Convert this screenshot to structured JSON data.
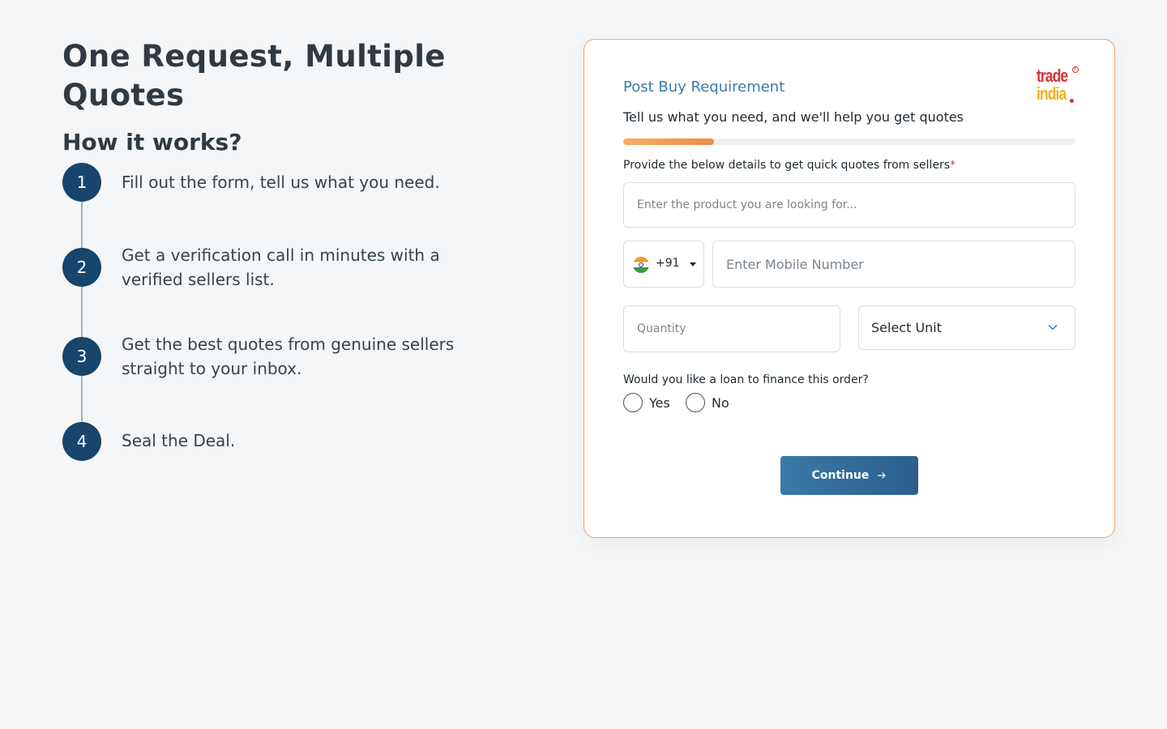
{
  "left": {
    "headline": "One Request, Multiple Quotes",
    "subhead": "How it works?",
    "steps": [
      {
        "number": "1",
        "text": "Fill out the form, tell us what you need."
      },
      {
        "number": "2",
        "text": "Get a verification call in minutes with a verified sellers list."
      },
      {
        "number": "3",
        "text": "Get the best quotes from genuine sellers straight to your inbox."
      },
      {
        "number": "4",
        "text": "Seal the Deal."
      }
    ]
  },
  "form": {
    "title": "Post Buy Requirement",
    "subtitle": "Tell us what you need, and we'll help you get quotes",
    "logo": {
      "line1": "trade",
      "line2": "india",
      "registered": "R"
    },
    "progress_fraction": 0.2,
    "details_label": "Provide the below details to get quick quotes from sellers",
    "required_marker": "*",
    "product_placeholder": "Enter the product you are looking for...",
    "country": {
      "flag_icon": "india-flag-icon",
      "code": "+91"
    },
    "mobile_placeholder": "Enter Mobile Number",
    "quantity_placeholder": "Quantity",
    "unit_select": "Select Unit",
    "loan_question": "Would you like a loan to finance this order?",
    "loan_options": [
      "Yes",
      "No"
    ],
    "continue_label": "Continue"
  },
  "colors": {
    "accent": "#17456b",
    "title_blue": "#3c7ba9",
    "card_border": "#f0a572",
    "progress": "#f2894a",
    "button": "#2f6a96"
  }
}
